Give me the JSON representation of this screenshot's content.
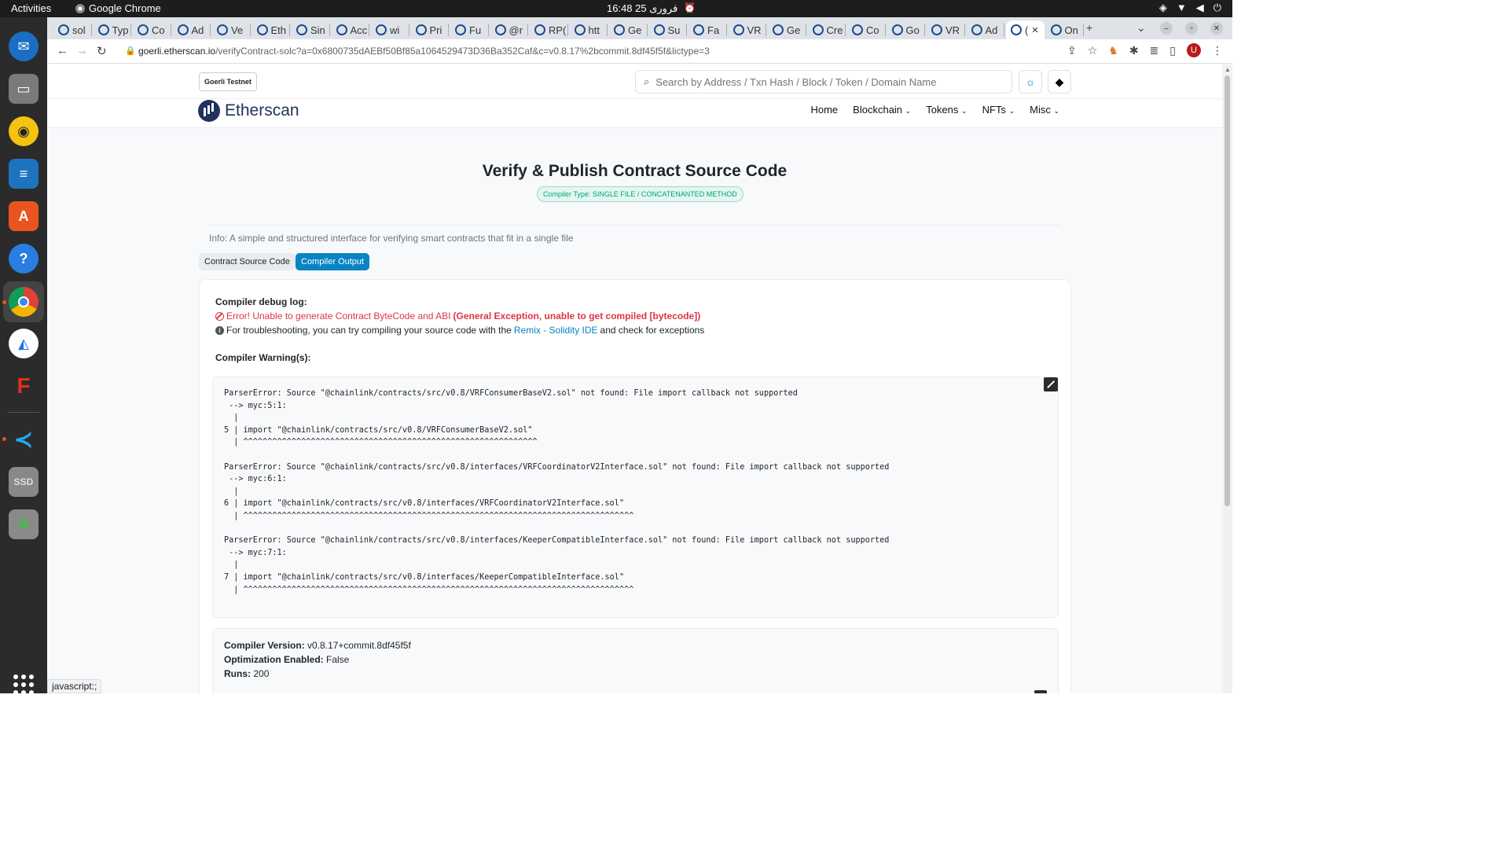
{
  "system": {
    "activities": "Activities",
    "app_name": "Google Chrome",
    "clock": "16:48 25 فروری"
  },
  "tabs": [
    {
      "label": "sol"
    },
    {
      "label": "Typ"
    },
    {
      "label": "Co"
    },
    {
      "label": "Ad"
    },
    {
      "label": "Ve"
    },
    {
      "label": "Eth"
    },
    {
      "label": "Sin"
    },
    {
      "label": "Acc"
    },
    {
      "label": "wi"
    },
    {
      "label": "Pri"
    },
    {
      "label": "Fu"
    },
    {
      "label": "@r"
    },
    {
      "label": "RP("
    },
    {
      "label": "htt"
    },
    {
      "label": "Ge"
    },
    {
      "label": "Su"
    },
    {
      "label": "Fa"
    },
    {
      "label": "VR"
    },
    {
      "label": "Ge"
    },
    {
      "label": "Cre"
    },
    {
      "label": "Co"
    },
    {
      "label": "Go"
    },
    {
      "label": "VR"
    },
    {
      "label": "Ad"
    },
    {
      "label": "("
    },
    {
      "label": "On"
    }
  ],
  "browser": {
    "url_host": "goerli.etherscan.io",
    "url_path": "/verifyContract-solc?a=0x6800735dAEBf50Bf85a1064529473D36Ba352Caf&c=v0.8.17%2bcommit.8df45f5f&lictype=3",
    "status_url": "javascript:;",
    "avatar_letter": "U"
  },
  "header": {
    "network_badge": "Goerli Testnet",
    "search_placeholder": "Search by Address / Txn Hash / Block / Token / Domain Name",
    "logo_text": "Etherscan",
    "nav": {
      "home": "Home",
      "blockchain": "Blockchain",
      "tokens": "Tokens",
      "nfts": "NFTs",
      "misc": "Misc"
    }
  },
  "main": {
    "title": "Verify & Publish Contract Source Code",
    "compiler_type_badge": "Compiler Type: SINGLE FILE / CONCATENANTED METHOD",
    "info": "Info: A simple and structured interface for verifying smart contracts that fit in a single file",
    "tabs": {
      "source": "Contract Source Code",
      "output": "Compiler Output"
    },
    "debug_title": "Compiler debug log:",
    "error_text": "Error! Unable to generate Contract ByteCode and ABI",
    "error_bold": "(General Exception, unable to get compiled [bytecode])",
    "tip_prefix": "For troubleshooting, you can try compiling your source code with the",
    "tip_link": "Remix - Solidity IDE",
    "tip_suffix": "and check for exceptions",
    "warnings_title": "Compiler Warning(s):",
    "warnings_log": "ParserError: Source \"@chainlink/contracts/src/v0.8/VRFConsumerBaseV2.sol\" not found: File import callback not supported\n --> myc:5:1:\n  |\n5 | import \"@chainlink/contracts/src/v0.8/VRFConsumerBaseV2.sol\"\n  | ^^^^^^^^^^^^^^^^^^^^^^^^^^^^^^^^^^^^^^^^^^^^^^^^^^^^^^^^^^^^^\n\nParserError: Source \"@chainlink/contracts/src/v0.8/interfaces/VRFCoordinatorV2Interface.sol\" not found: File import callback not supported\n --> myc:6:1:\n  |\n6 | import \"@chainlink/contracts/src/v0.8/interfaces/VRFCoordinatorV2Interface.sol\"\n  | ^^^^^^^^^^^^^^^^^^^^^^^^^^^^^^^^^^^^^^^^^^^^^^^^^^^^^^^^^^^^^^^^^^^^^^^^^^^^^^^^^\n\nParserError: Source \"@chainlink/contracts/src/v0.8/interfaces/KeeperCompatibleInterface.sol\" not found: File import callback not supported\n --> myc:7:1:\n  |\n7 | import \"@chainlink/contracts/src/v0.8/interfaces/KeeperCompatibleInterface.sol\"\n  | ^^^^^^^^^^^^^^^^^^^^^^^^^^^^^^^^^^^^^^^^^^^^^^^^^^^^^^^^^^^^^^^^^^^^^^^^^^^^^^^^^",
    "meta": {
      "version_label": "Compiler Version:",
      "version_value": "v0.8.17+commit.8df45f5f",
      "optimization_label": "Optimization Enabled:",
      "optimization_value": "False",
      "runs_label": "Runs:",
      "runs_value": "200"
    }
  },
  "dock": {
    "ssd_label": "SSD"
  },
  "colors": {
    "accent": "#0784c3",
    "error": "#dc3545",
    "badge_green": "#00a186",
    "brand_navy": "#21325b"
  }
}
